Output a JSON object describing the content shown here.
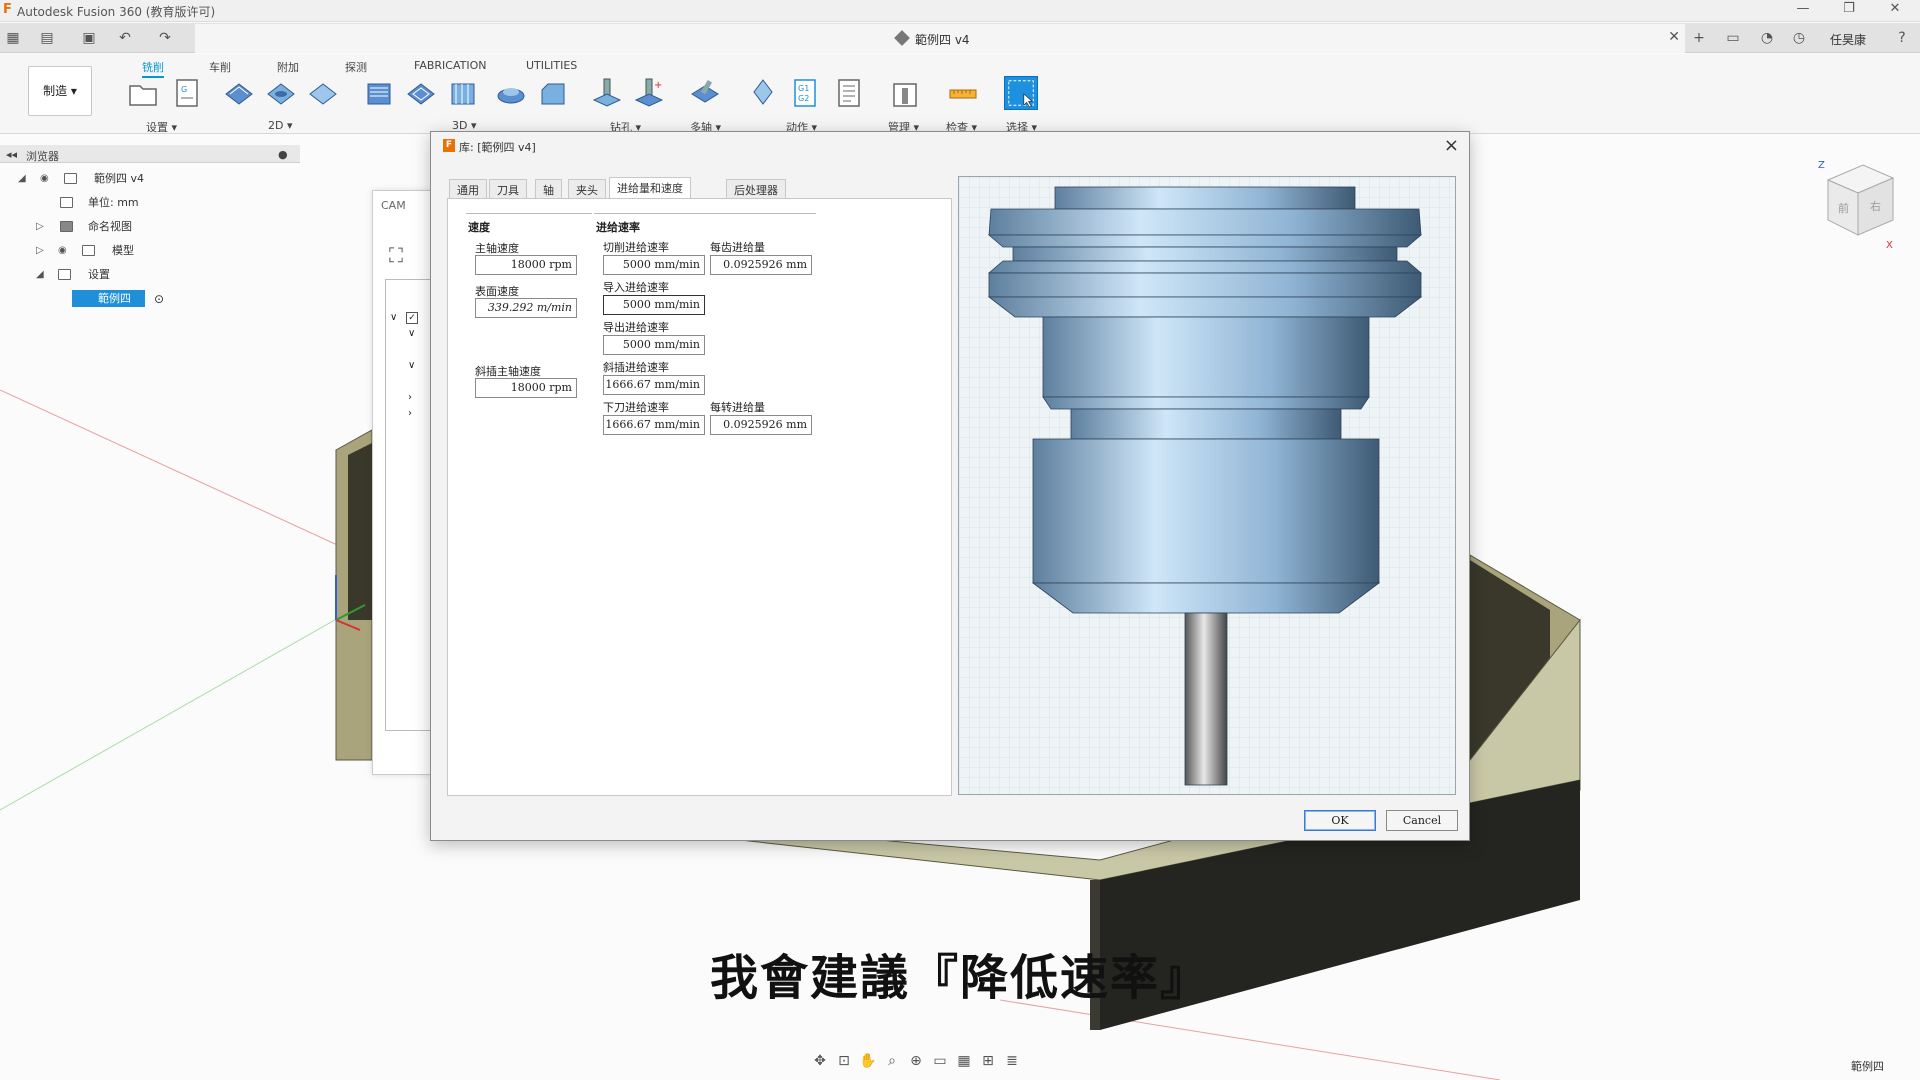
{
  "titlebar": {
    "app_title": "Autodesk Fusion 360 (教育版许可)",
    "minimize": "—",
    "restore": "❐",
    "close": "✕"
  },
  "document": {
    "title": "範例四 v4",
    "close_icon": "✕"
  },
  "user": {
    "name": "任昊康"
  },
  "ribbon": {
    "workspace_label": "制造 ▾",
    "tabs": [
      "铣削",
      "车削",
      "附加",
      "探测",
      "FABRICATION",
      "UTILITIES"
    ],
    "active_tab": "铣削",
    "groups": [
      "设置 ▾",
      "2D ▾",
      "3D ▾",
      "钻孔 ▾",
      "多轴 ▾",
      "动作 ▾",
      "管理 ▾",
      "检查 ▾",
      "选择 ▾"
    ]
  },
  "browser": {
    "header": "浏览器",
    "items": [
      {
        "label": "範例四 v4"
      },
      {
        "label": "单位: mm"
      },
      {
        "label": "命名视图"
      },
      {
        "label": "模型"
      },
      {
        "label": "设置"
      },
      {
        "label": "範例四"
      }
    ]
  },
  "cam_panel": {
    "title": "CAM"
  },
  "dialog": {
    "title": "库: [範例四 v4]",
    "tabs": [
      "通用",
      "刀具",
      "轴",
      "夹头",
      "进给量和速度",
      "后处理器"
    ],
    "active_tab": "进给量和速度",
    "speed_section": "速度",
    "feed_section": "进给速率",
    "fields": {
      "spindle_speed": {
        "label": "主轴速度",
        "value": "18000 rpm"
      },
      "surface_speed": {
        "label": "表面速度",
        "value": "339.292 m/min"
      },
      "ramp_spindle_speed": {
        "label": "斜插主轴速度",
        "value": "18000 rpm"
      },
      "cutting_feedrate": {
        "label": "切削进给速率",
        "value": "5000 mm/min"
      },
      "feed_per_tooth": {
        "label": "每齿进给量",
        "value": "0.0925926 mm"
      },
      "lead_in_feedrate": {
        "label": "导入进给速率",
        "value": "5000 mm/min"
      },
      "lead_out_feedrate": {
        "label": "导出进给速率",
        "value": "5000 mm/min"
      },
      "ramp_feedrate": {
        "label": "斜插进给速率",
        "value": "1666.67 mm/min"
      },
      "plunge_feedrate": {
        "label": "下刀进给速率",
        "value": "1666.67 mm/min"
      },
      "feed_per_revolution": {
        "label": "每转进给量",
        "value": "0.0925926 mm"
      }
    },
    "ok_label": "OK",
    "cancel_label": "Cancel"
  },
  "subtitle": "我會建議『降低速率』",
  "status": {
    "bottom_right": "範例四"
  },
  "viewcube": {
    "front": "前",
    "right": "右",
    "z": "Z",
    "x": "X"
  },
  "colors": {
    "accent": "#0696d7",
    "selection": "#1e8fd8",
    "tool_body": "#8fb4d4",
    "stock": "#c9c8a6"
  }
}
